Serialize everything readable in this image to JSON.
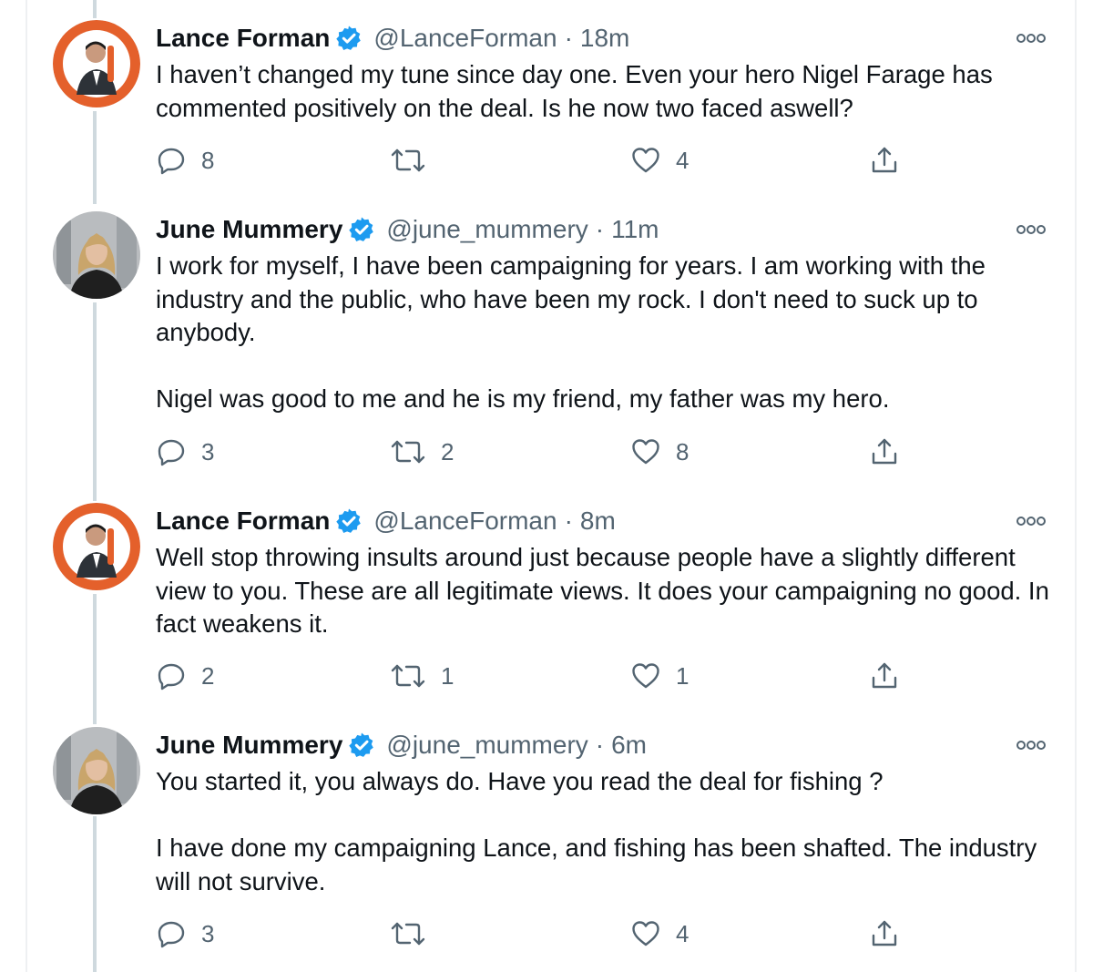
{
  "colors": {
    "verified": "#1d9bf0",
    "secondary": "#536471",
    "thread_line": "#cfd9de"
  },
  "tweets": [
    {
      "author": "Lance Forman",
      "handle": "@LanceForman",
      "separator": "·",
      "time": "18m",
      "avatar": "lance-avatar",
      "paragraphs": [
        "I haven’t changed my tune since day one.  Even your hero Nigel Farage has commented positively on the deal. Is he now two faced aswell?"
      ],
      "replies": "8",
      "retweets": "",
      "likes": "4"
    },
    {
      "author": "June Mummery",
      "handle": "@june_mummery",
      "separator": "·",
      "time": "11m",
      "avatar": "june-avatar",
      "paragraphs": [
        "I work for myself, I have been campaigning for years. I am working with the industry and the public, who have been my rock. I don't  need to suck up to anybody.",
        "Nigel was good to me and he is my friend, my father was my hero."
      ],
      "replies": "3",
      "retweets": "2",
      "likes": "8"
    },
    {
      "author": "Lance Forman",
      "handle": "@LanceForman",
      "separator": "·",
      "time": "8m",
      "avatar": "lance-avatar",
      "paragraphs": [
        "Well stop throwing insults around just because people have a slightly different view to you. These are all legitimate views. It does your campaigning no good. In fact weakens it."
      ],
      "replies": "2",
      "retweets": "1",
      "likes": "1"
    },
    {
      "author": "June Mummery",
      "handle": "@june_mummery",
      "separator": "·",
      "time": "6m",
      "avatar": "june-avatar",
      "paragraphs": [
        "You started it, you always do. Have you read the deal for fishing ?",
        "I have done my campaigning Lance, and fishing has been shafted. The industry will not survive."
      ],
      "replies": "3",
      "retweets": "",
      "likes": "4"
    }
  ],
  "icons": {
    "verified": "verified-badge-icon",
    "more": "more-options-icon",
    "reply": "reply-icon",
    "retweet": "retweet-icon",
    "like": "heart-icon",
    "share": "share-icon"
  }
}
